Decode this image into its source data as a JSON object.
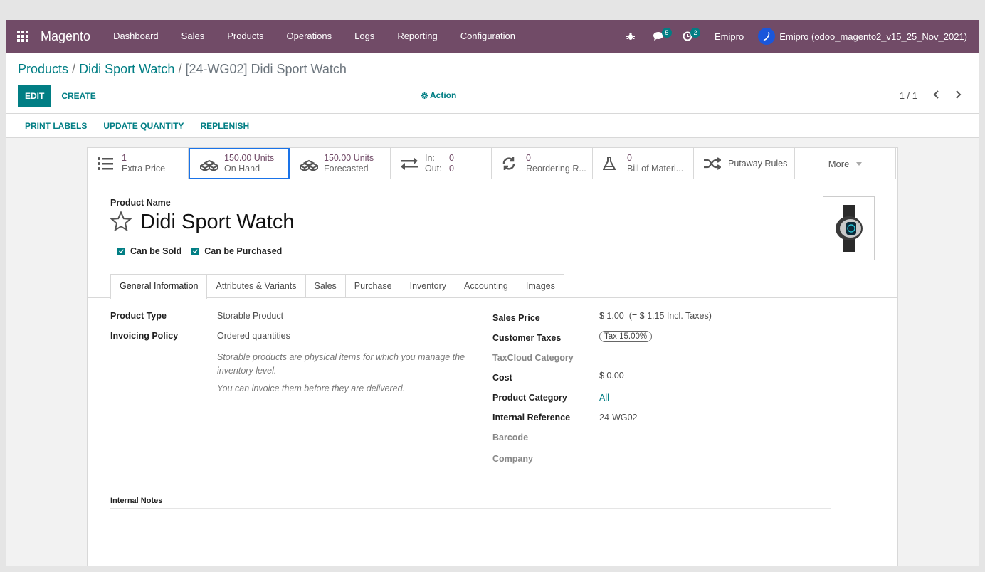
{
  "navbar": {
    "brand": "Magento",
    "menu": [
      "Dashboard",
      "Sales",
      "Products",
      "Operations",
      "Logs",
      "Reporting",
      "Configuration"
    ],
    "messages_count": "5",
    "activities_count": "2",
    "company": "Emipro",
    "user": "Emipro (odoo_magento2_v15_25_Nov_2021)"
  },
  "breadcrumb": {
    "root": "Products",
    "sep1": " / ",
    "parent": "Didi Sport Watch",
    "sep2": " / ",
    "current": "[24-WG02] Didi Sport Watch"
  },
  "cp": {
    "edit": "EDIT",
    "create": "CREATE",
    "action": "Action",
    "pager": "1 / 1"
  },
  "statusbar": {
    "print_labels": "PRINT LABELS",
    "update_quantity": "UPDATE QUANTITY",
    "replenish": "REPLENISH"
  },
  "smart_buttons": {
    "extra_price": {
      "value": "1",
      "label": "Extra Price"
    },
    "on_hand": {
      "value": "150.00 Units",
      "label": "On Hand"
    },
    "forecasted": {
      "value": "150.00 Units",
      "label": "Forecasted"
    },
    "in_out": {
      "in_label": "In:",
      "in_value": "0",
      "out_label": "Out:",
      "out_value": "0"
    },
    "reordering": {
      "value": "0",
      "label": "Reordering R..."
    },
    "bom": {
      "value": "0",
      "label": "Bill of Materi..."
    },
    "putaway": {
      "label": "Putaway Rules"
    },
    "more": "More"
  },
  "product": {
    "name_label": "Product Name",
    "name": "Didi Sport Watch",
    "can_be_sold": "Can be Sold",
    "can_be_purchased": "Can be Purchased"
  },
  "tabs": [
    "General Information",
    "Attributes & Variants",
    "Sales",
    "Purchase",
    "Inventory",
    "Accounting",
    "Images"
  ],
  "general": {
    "product_type_label": "Product Type",
    "product_type": "Storable Product",
    "invoicing_policy_label": "Invoicing Policy",
    "invoicing_policy": "Ordered quantities",
    "help1": "Storable products are physical items for which you manage the inventory level.",
    "help2": "You can invoice them before they are delivered.",
    "sales_price_label": "Sales Price",
    "sales_price": "$ 1.00",
    "sales_price_incl": "(= $ 1.15 Incl. Taxes)",
    "customer_taxes_label": "Customer Taxes",
    "customer_tax": "Tax 15.00%",
    "taxcloud_label": "TaxCloud Category",
    "cost_label": "Cost",
    "cost": "$ 0.00",
    "category_label": "Product Category",
    "category": "All",
    "internal_ref_label": "Internal Reference",
    "internal_ref": "24-WG02",
    "barcode_label": "Barcode",
    "company_label": "Company",
    "notes_label": "Internal Notes"
  },
  "colors": {
    "navbar": "#714b67",
    "primary": "#017e84",
    "active_outline": "#1a73e8"
  }
}
